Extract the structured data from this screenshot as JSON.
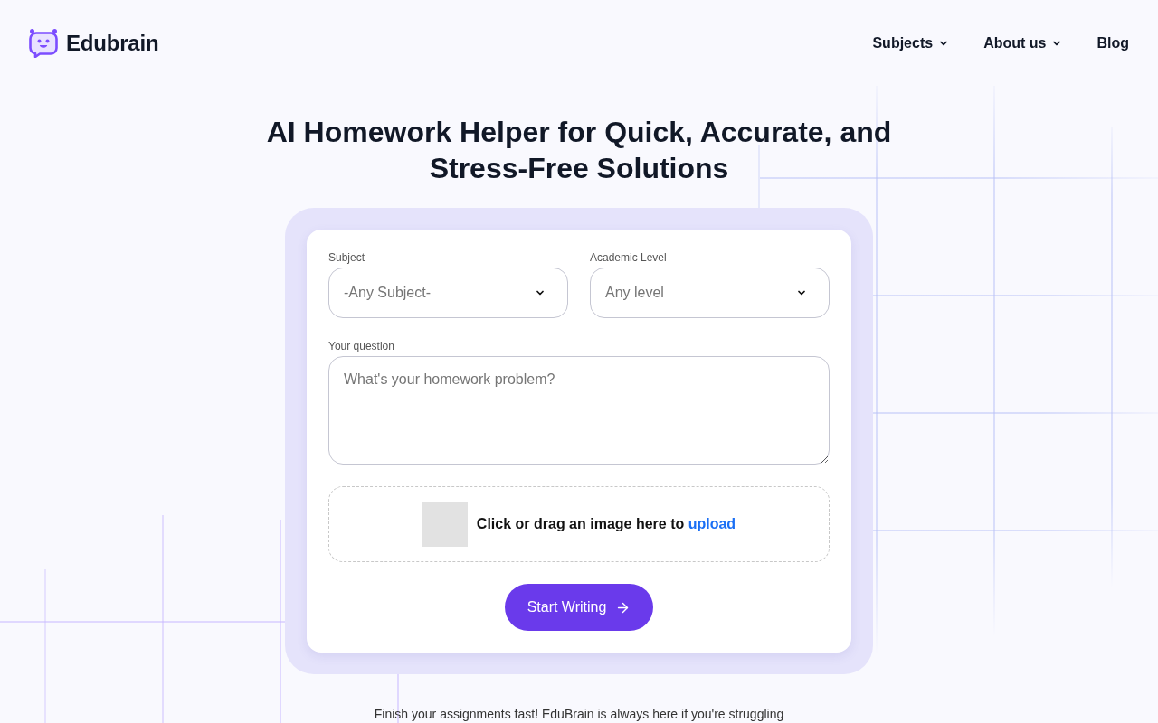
{
  "header": {
    "logo": {
      "text": "Edubrain"
    },
    "nav": [
      {
        "label": "Subjects",
        "kind": "dropdown"
      },
      {
        "label": "About us",
        "kind": "dropdown"
      },
      {
        "label": "Blog",
        "kind": "link"
      }
    ]
  },
  "hero": {
    "title": "AI Homework Helper for Quick, Accurate, and Stress-Free Solutions"
  },
  "form": {
    "fields": [
      {
        "label": "Subject",
        "value": "-Any Subject-"
      },
      {
        "label": "Academic Level",
        "value": "Any level"
      }
    ],
    "question": {
      "label": "Your question",
      "placeholder": "What's your homework problem?"
    },
    "upload": {
      "text": "Click or drag an image here to",
      "link": "upload"
    },
    "submit": {
      "label": "Start Writing"
    }
  },
  "intro": {
    "text": "Finish your assignments fast! EduBrain is always here if you're struggling"
  }
}
